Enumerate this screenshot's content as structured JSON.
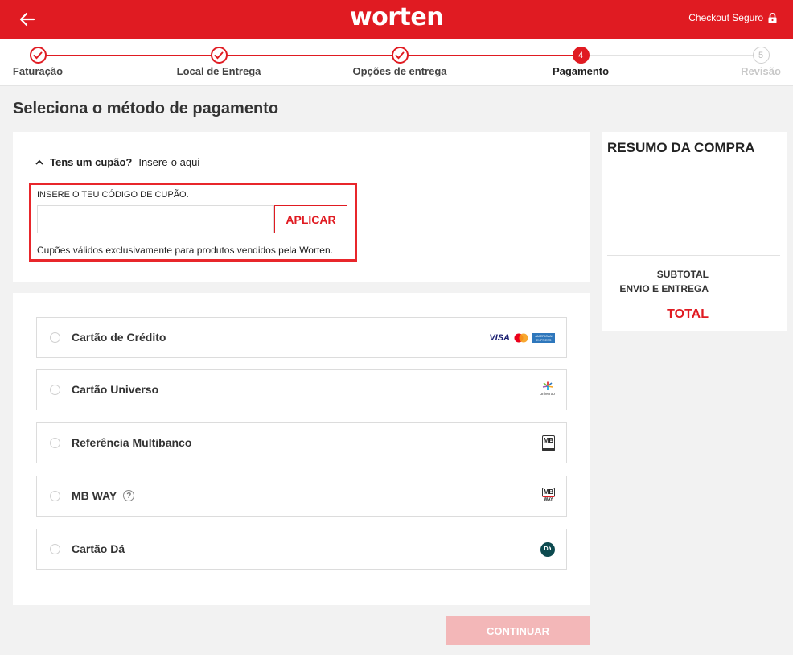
{
  "header": {
    "logo": "worten",
    "secure_label": "Checkout Seguro"
  },
  "stepper": {
    "steps": [
      {
        "label": "Faturação",
        "state": "done",
        "number": "1"
      },
      {
        "label": "Local de Entrega",
        "state": "done",
        "number": "2"
      },
      {
        "label": "Opções de entrega",
        "state": "done",
        "number": "3"
      },
      {
        "label": "Pagamento",
        "state": "current",
        "number": "4"
      },
      {
        "label": "Revisão",
        "state": "pending",
        "number": "5"
      }
    ]
  },
  "page_title": "Seleciona o método de pagamento",
  "coupon": {
    "question": "Tens um cupão?",
    "link": "Insere-o aqui",
    "input_label": "INSERE O TEU CÓDIGO DE CUPÃO.",
    "input_value": "",
    "apply_label": "APLICAR",
    "note": "Cupões válidos exclusivamente para produtos vendidos pela Worten."
  },
  "payment": {
    "options": [
      {
        "label": "Cartão de Crédito",
        "logo": "card-brands-icon"
      },
      {
        "label": "Cartão Universo",
        "logo": "universo-icon"
      },
      {
        "label": "Referência Multibanco",
        "logo": "multibanco-icon"
      },
      {
        "label": "MB WAY",
        "logo": "mbway-icon",
        "help": "?"
      },
      {
        "label": "Cartão Dá",
        "logo": "cartao-da-icon"
      }
    ],
    "visa_text": "VISA",
    "amex_text": "AMERICAN EXPRESS",
    "universo_text": "universo",
    "mb_text": "MB",
    "mbway_text": "WAY",
    "da_text": "Dá"
  },
  "summary": {
    "title": "RESUMO DA COMPRA",
    "subtotal_label": "SUBTOTAL",
    "shipping_label": "ENVIO E ENTREGA",
    "total_label": "TOTAL"
  },
  "continue_label": "CONTINUAR",
  "colors": {
    "brand_red": "#e01b22",
    "disabled_button": "#f3b7b8",
    "highlight_box": "#e8262b"
  }
}
